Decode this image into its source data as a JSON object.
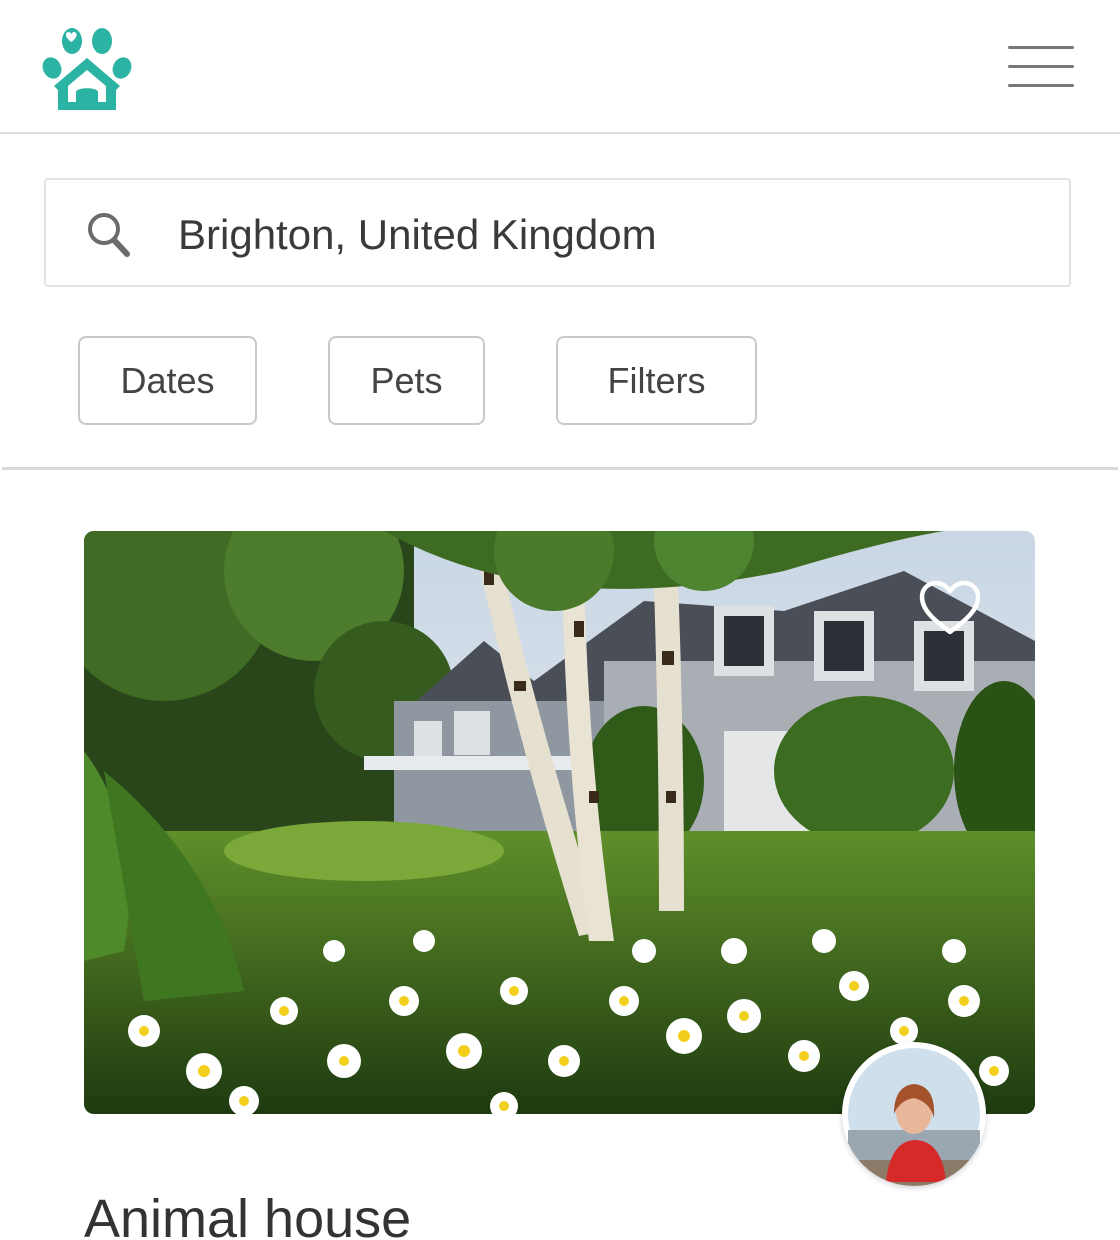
{
  "header": {
    "logo_icon": "paw-house-logo",
    "brand_color": "#2bb3a3",
    "menu_icon": "hamburger-menu-icon"
  },
  "search": {
    "icon": "search-icon",
    "value": "Brighton, United Kingdom"
  },
  "filters": [
    {
      "label": "Dates"
    },
    {
      "label": "Pets"
    },
    {
      "label": "Filters"
    }
  ],
  "listing": {
    "photo": "house-with-garden-photo",
    "favorite_icon": "heart-outline-icon",
    "host_avatar": "host-avatar",
    "title": "Animal house"
  }
}
